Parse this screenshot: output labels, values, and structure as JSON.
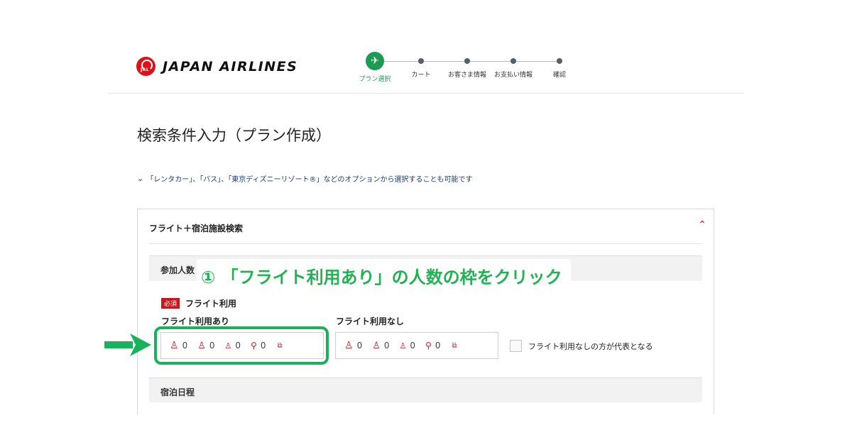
{
  "header": {
    "logo_text": "JAPAN AIRLINES",
    "logo_badge": "JAL",
    "steps": [
      {
        "label": "プラン選択",
        "active": true
      },
      {
        "label": "カート",
        "active": false
      },
      {
        "label": "お客さま情報",
        "active": false
      },
      {
        "label": "お支払い情報",
        "active": false
      },
      {
        "label": "確認",
        "active": false
      }
    ]
  },
  "page": {
    "title": "検索条件入力（プラン作成）",
    "notice": "「レンタカー」、「バス」、「東京ディズニーリゾート®」などのオプションから選択することも可能です"
  },
  "panel": {
    "title": "フライト＋宿泊施設検索",
    "section_passengers": "参加人数",
    "required_tag": "必須",
    "flight_use_label": "フライト利用",
    "with_flight_label": "フライト利用あり",
    "without_flight_label": "フライト利用なし",
    "with_flight_counts": [
      "0",
      "0",
      "0",
      "0"
    ],
    "without_flight_counts": [
      "0",
      "0",
      "0",
      "0"
    ],
    "checkbox_label": "フライト利用なしの方が代表となる",
    "section_stay": "宿泊日程"
  },
  "annotation": {
    "callout": "① 「フライト利用あり」の人数の枠をクリック",
    "highlight_color": "#18b25a"
  },
  "colors": {
    "brand_red": "#d7141b",
    "step_active": "#1e9a53"
  }
}
